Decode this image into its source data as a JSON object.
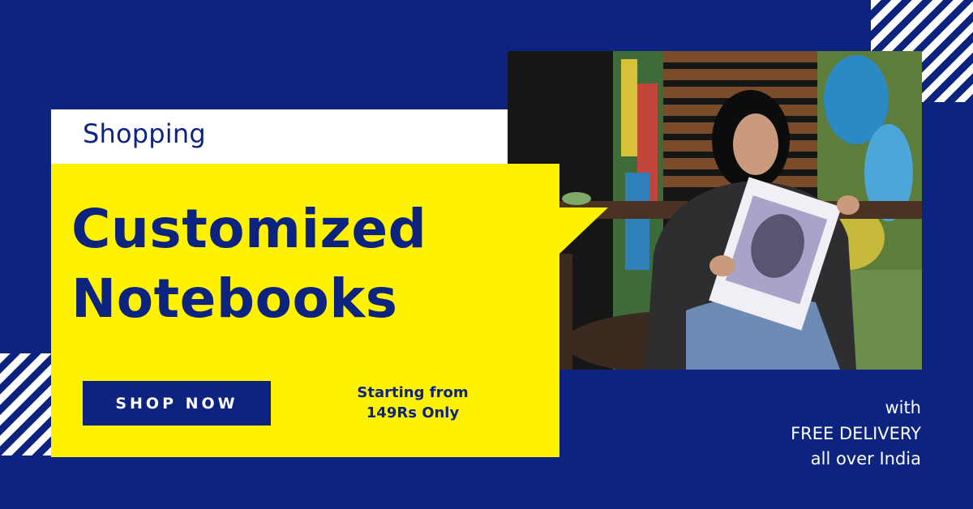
{
  "ad": {
    "tab_label": "Shopping",
    "headline_line1": "Customized",
    "headline_line2": "Notebooks",
    "cta_label": "SHOP NOW",
    "price_line1": "Starting from",
    "price_line2": "149Rs Only",
    "delivery_line1": "with",
    "delivery_line2": "FREE DELIVERY",
    "delivery_line3": "all over India"
  },
  "colors": {
    "background": "#0d2380",
    "accent_yellow": "#fff200",
    "white": "#ffffff"
  },
  "photo": {
    "subject": "woman-holding-notebook-photo"
  }
}
